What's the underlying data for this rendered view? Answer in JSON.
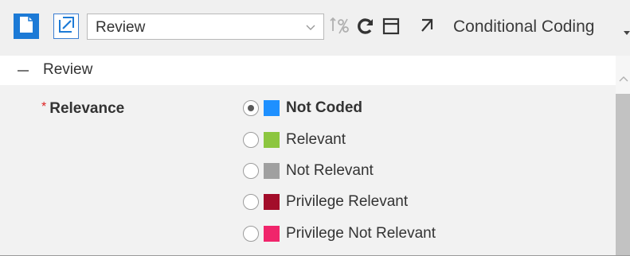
{
  "toolbar": {
    "view_select": {
      "value": "Review"
    },
    "icons": [
      "new-document-icon",
      "edit-document-icon",
      "field-order-icon",
      "refresh-icon",
      "layout-icon",
      "pop-out-icon"
    ],
    "conditional_label": "Conditional Coding"
  },
  "section": {
    "title": "Review"
  },
  "field": {
    "required_mark": "*",
    "label": "Relevance",
    "choices": [
      {
        "label": "Not Coded",
        "color": "#1e90ff",
        "selected": true
      },
      {
        "label": "Relevant",
        "color": "#8cc63f",
        "selected": false
      },
      {
        "label": "Not Relevant",
        "color": "#a0a0a0",
        "selected": false
      },
      {
        "label": "Privilege Relevant",
        "color": "#a30d2a",
        "selected": false
      },
      {
        "label": "Privilege Not Relevant",
        "color": "#f0256b",
        "selected": false
      }
    ]
  }
}
